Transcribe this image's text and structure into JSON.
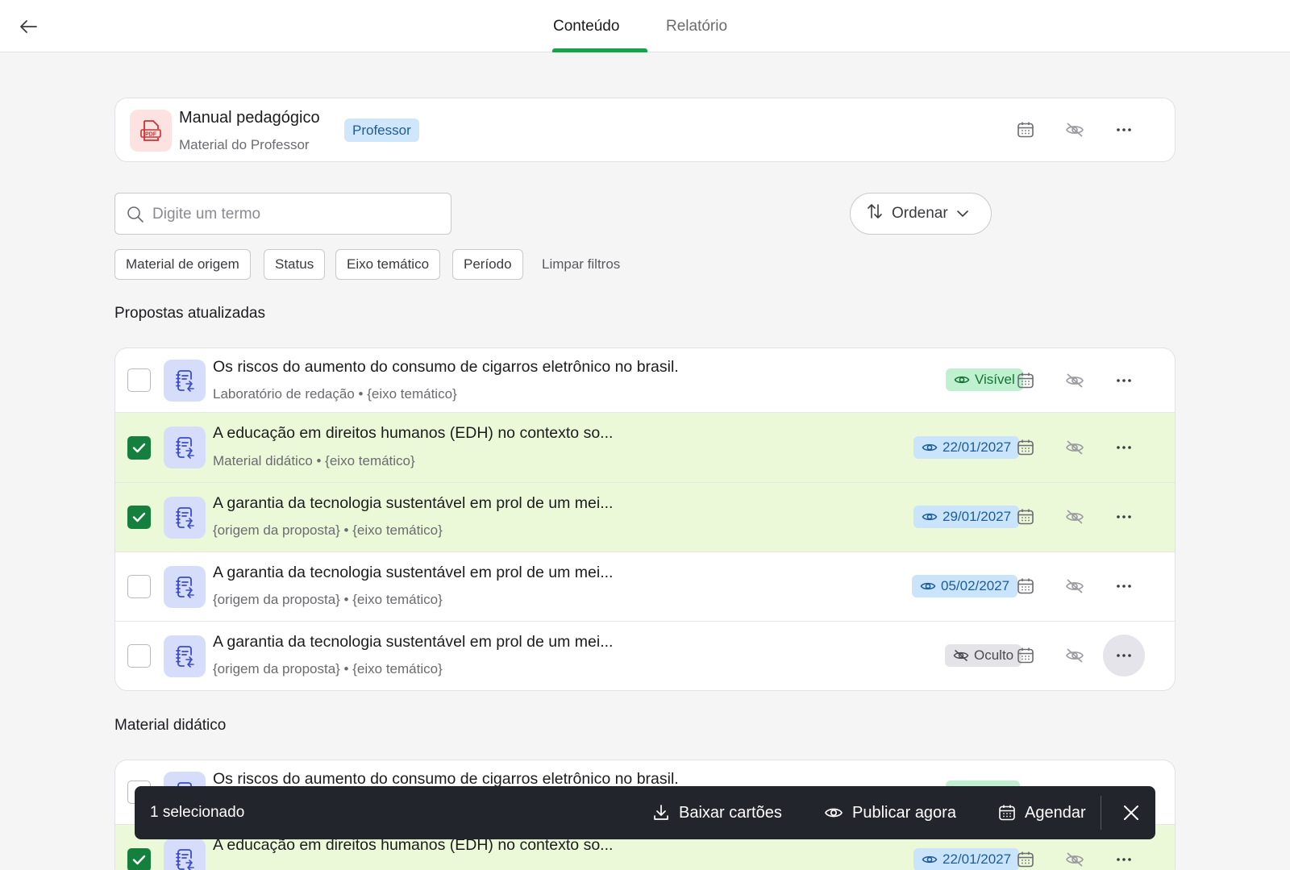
{
  "header": {
    "tabs": [
      {
        "label": "Conteúdo",
        "active": true
      },
      {
        "label": "Relatório",
        "active": false
      }
    ],
    "accent_color": "#16a34a"
  },
  "material": {
    "title": "Manual pedagógico",
    "subtitle": "Material do Professor",
    "badge": "Professor",
    "icon": "pdf-icon"
  },
  "search": {
    "placeholder": "Digite um termo",
    "value": ""
  },
  "sort": {
    "label": "Ordenar"
  },
  "filters": {
    "chips": [
      "Material de origem",
      "Status",
      "Eixo temático",
      "Período"
    ],
    "clear_label": "Limpar filtros"
  },
  "sections": [
    {
      "title": "Propostas atualizadas",
      "rows": [
        {
          "title": "Os riscos do aumento do consumo de cigarros eletrônico no brasil.",
          "subtitle": "Laboratório de redação • {eixo temático}",
          "status": "Visível",
          "status_type": "visible",
          "selected": false
        },
        {
          "title": "A educação em direitos humanos (EDH) no contexto so...",
          "subtitle": "Material didático • {eixo temático}",
          "status": "22/01/2027",
          "status_type": "date",
          "selected": true
        },
        {
          "title": "A garantia da tecnologia sustentável em prol de um mei...",
          "subtitle": "{origem da proposta} • {eixo temático}",
          "status": "29/01/2027",
          "status_type": "date",
          "selected": true
        },
        {
          "title": "A garantia da tecnologia sustentável em prol de um mei...",
          "subtitle": "{origem da proposta} • {eixo temático}",
          "status": "05/02/2027",
          "status_type": "date",
          "selected": false
        },
        {
          "title": "A garantia da tecnologia sustentável em prol de um mei...",
          "subtitle": "{origem da proposta} • {eixo temático}",
          "status": "Oculto",
          "status_type": "hidden",
          "selected": false
        }
      ]
    },
    {
      "title": "Material didático",
      "rows": [
        {
          "title": "Os riscos do aumento do consumo de cigarros eletrônico no brasil.",
          "subtitle": "",
          "status": "",
          "status_type": "visible",
          "selected": false
        },
        {
          "title": "A educação em direitos humanos (EDH) no contexto so...",
          "subtitle": "",
          "status": "22/01/2027",
          "status_type": "date",
          "selected": true
        }
      ]
    }
  ],
  "action_bar": {
    "count_label": "1 selecionado",
    "download_label": "Baixar cartões",
    "publish_label": "Publicar agora",
    "schedule_label": "Agendar"
  }
}
